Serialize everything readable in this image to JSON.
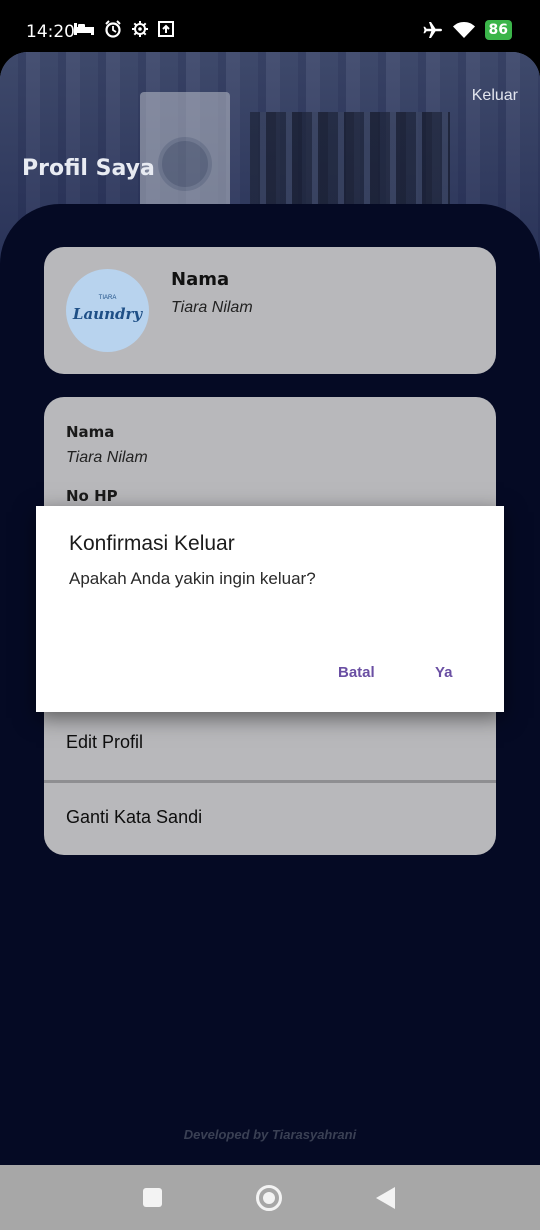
{
  "status_bar": {
    "time": "14:20",
    "battery": "86"
  },
  "header": {
    "title": "Profil Saya",
    "logout_label": "Keluar"
  },
  "profile_card": {
    "avatar_brand": "Laundry",
    "avatar_small_text": "TIARA",
    "name_label": "Nama",
    "name_value": "Tiara Nilam"
  },
  "details_card": {
    "fields": [
      {
        "label": "Nama",
        "value": "Tiara Nilam"
      },
      {
        "label": "No HP",
        "value": ""
      }
    ]
  },
  "menu": {
    "items": [
      {
        "label": "Edit Profil"
      },
      {
        "label": "Ganti Kata Sandi"
      }
    ]
  },
  "footer": {
    "credit": "Developed by Tiarasyahrani"
  },
  "dialog": {
    "title": "Konfirmasi Keluar",
    "message": "Apakah Anda yakin ingin keluar?",
    "cancel_label": "Batal",
    "confirm_label": "Ya"
  },
  "colors": {
    "accent": "#6a4fa3",
    "app_background": "#050a24",
    "card": "#b8b8bb"
  }
}
